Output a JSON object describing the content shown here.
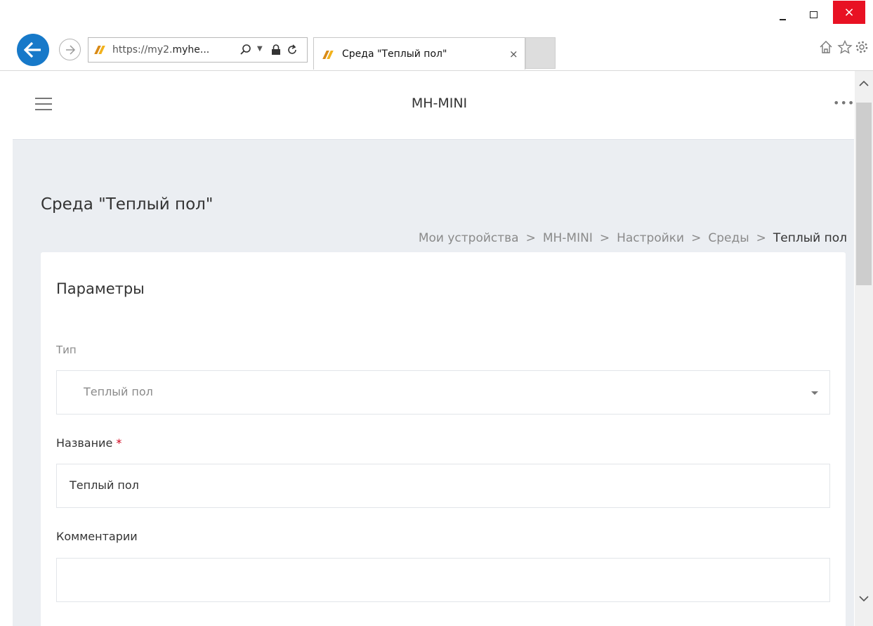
{
  "browser": {
    "address": {
      "prefix": "https://my2.",
      "host": "myhe...",
      "full": "https://my2.myhe..."
    },
    "tab_title": "Среда \"Теплый пол\"",
    "tab_close": "×",
    "close_glyph": "×"
  },
  "app": {
    "title": "MH-MINI",
    "menu_glyph": "•••"
  },
  "page": {
    "title": "Среда \"Теплый пол\"",
    "breadcrumb": {
      "items": [
        "Мои устройства",
        "MH-MINI",
        "Настройки",
        "Среды"
      ],
      "current": "Теплый пол",
      "separator": ">"
    }
  },
  "form": {
    "section_title": "Параметры",
    "type": {
      "label": "Тип",
      "value": "Теплый пол"
    },
    "name": {
      "label": "Название",
      "required_mark": "*",
      "value": "Теплый пол"
    },
    "comments": {
      "label": "Комментарии",
      "value": ""
    }
  }
}
